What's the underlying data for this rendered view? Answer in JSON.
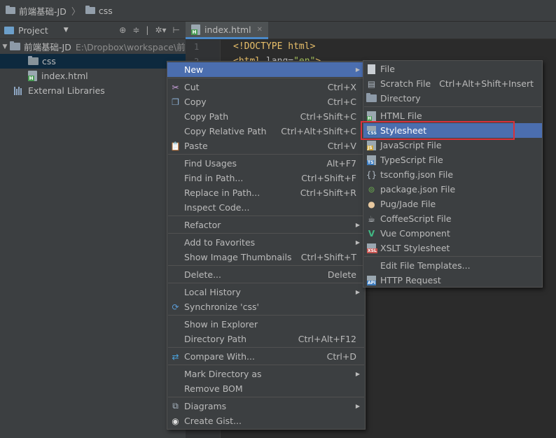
{
  "breadcrumb": {
    "project": "前端基础-JD",
    "folder": "css"
  },
  "project_panel": {
    "title": "Project",
    "tree": {
      "root_name": "前端基础-JD",
      "root_path": "E:\\Dropbox\\workspace\\前",
      "css_folder": "css",
      "index_file": "index.html",
      "external_libraries": "External Libraries"
    }
  },
  "editor": {
    "tab_label": "index.html",
    "lines": [
      "1",
      "2"
    ],
    "code": {
      "doctype": "<!DOCTYPE html>",
      "html_open": "<html",
      "lang_attr": "lang=",
      "lang_val": "\"en\"",
      "close": ">"
    }
  },
  "context_menu": {
    "items": [
      {
        "label": "New",
        "shortcut": ""
      },
      {
        "label": "Cut",
        "shortcut": "Ctrl+X"
      },
      {
        "label": "Copy",
        "shortcut": "Ctrl+C"
      },
      {
        "label": "Copy Path",
        "shortcut": "Ctrl+Shift+C"
      },
      {
        "label": "Copy Relative Path",
        "shortcut": "Ctrl+Alt+Shift+C"
      },
      {
        "label": "Paste",
        "shortcut": "Ctrl+V"
      },
      {
        "label": "Find Usages",
        "shortcut": "Alt+F7"
      },
      {
        "label": "Find in Path...",
        "shortcut": "Ctrl+Shift+F"
      },
      {
        "label": "Replace in Path...",
        "shortcut": "Ctrl+Shift+R"
      },
      {
        "label": "Inspect Code...",
        "shortcut": ""
      },
      {
        "label": "Refactor",
        "shortcut": ""
      },
      {
        "label": "Add to Favorites",
        "shortcut": ""
      },
      {
        "label": "Show Image Thumbnails",
        "shortcut": "Ctrl+Shift+T"
      },
      {
        "label": "Delete...",
        "shortcut": "Delete"
      },
      {
        "label": "Local History",
        "shortcut": ""
      },
      {
        "label": "Synchronize 'css'",
        "shortcut": ""
      },
      {
        "label": "Show in Explorer",
        "shortcut": ""
      },
      {
        "label": "Directory Path",
        "shortcut": "Ctrl+Alt+F12"
      },
      {
        "label": "Compare With...",
        "shortcut": "Ctrl+D"
      },
      {
        "label": "Mark Directory as",
        "shortcut": ""
      },
      {
        "label": "Remove BOM",
        "shortcut": ""
      },
      {
        "label": "Diagrams",
        "shortcut": ""
      },
      {
        "label": "Create Gist...",
        "shortcut": ""
      }
    ]
  },
  "new_submenu": {
    "items": [
      {
        "label": "File",
        "shortcut": ""
      },
      {
        "label": "Scratch File",
        "shortcut": "Ctrl+Alt+Shift+Insert"
      },
      {
        "label": "Directory",
        "shortcut": ""
      },
      {
        "label": "HTML File",
        "shortcut": ""
      },
      {
        "label": "Stylesheet",
        "shortcut": ""
      },
      {
        "label": "JavaScript File",
        "shortcut": ""
      },
      {
        "label": "TypeScript File",
        "shortcut": ""
      },
      {
        "label": "tsconfig.json File",
        "shortcut": ""
      },
      {
        "label": "package.json File",
        "shortcut": ""
      },
      {
        "label": "Pug/Jade File",
        "shortcut": ""
      },
      {
        "label": "CoffeeScript File",
        "shortcut": ""
      },
      {
        "label": "Vue Component",
        "shortcut": ""
      },
      {
        "label": "XSLT Stylesheet",
        "shortcut": ""
      },
      {
        "label": "Edit File Templates...",
        "shortcut": ""
      },
      {
        "label": "HTTP Request",
        "shortcut": ""
      }
    ],
    "icon_tags": {
      "html": "H",
      "css": "CSS",
      "js": "JS",
      "ts": "TS",
      "xsl": "XSL",
      "api": "API",
      "vue": "V"
    }
  },
  "colors": {
    "menu_bg": "#3c3f41",
    "selection": "#4b6eaf",
    "highlight_border": "#d9313a",
    "tree_selected": "#0d293e"
  }
}
